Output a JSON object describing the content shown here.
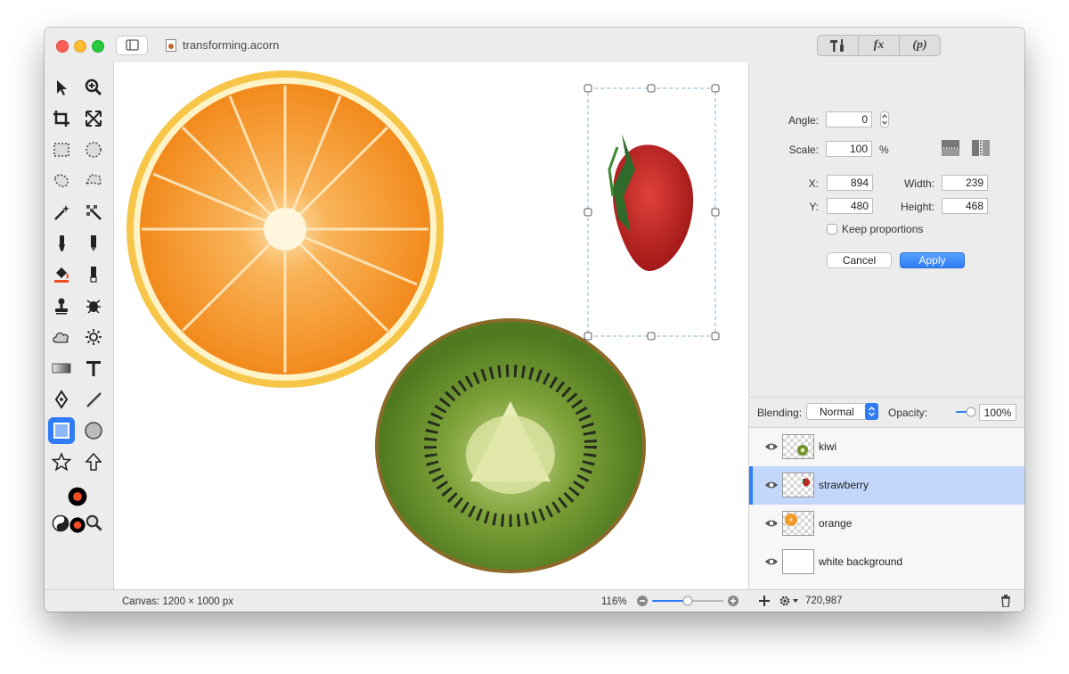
{
  "window": {
    "title": "transforming.acorn"
  },
  "toolbar_segments": [
    {
      "icon": "tools-icon"
    },
    {
      "label": "fx"
    },
    {
      "label": "(p)"
    }
  ],
  "transform": {
    "angle_label": "Angle:",
    "angle_value": "0",
    "scale_label": "Scale:",
    "scale_value": "100",
    "scale_unit": "%",
    "x_label": "X:",
    "x_value": "894",
    "y_label": "Y:",
    "y_value": "480",
    "width_label": "Width:",
    "width_value": "239",
    "height_label": "Height:",
    "height_value": "468",
    "keep_proportions_label": "Keep proportions",
    "keep_proportions_checked": false,
    "cancel_label": "Cancel",
    "apply_label": "Apply"
  },
  "layers_panel": {
    "blending_label": "Blending:",
    "blending_value": "Normal",
    "opacity_label": "Opacity:",
    "opacity_value": "100%",
    "layers": [
      {
        "name": "kiwi",
        "selected": false
      },
      {
        "name": "strawberry",
        "selected": true
      },
      {
        "name": "orange",
        "selected": false
      },
      {
        "name": "white background",
        "selected": false
      }
    ],
    "footer_count": "720,987"
  },
  "status": {
    "canvas_info": "Canvas: 1200 × 1000 px",
    "zoom": "116%"
  },
  "colors": {
    "accent": "#2f7cf6",
    "foreground_color": "#f04e23",
    "selection_row": "#c3d6fb"
  }
}
